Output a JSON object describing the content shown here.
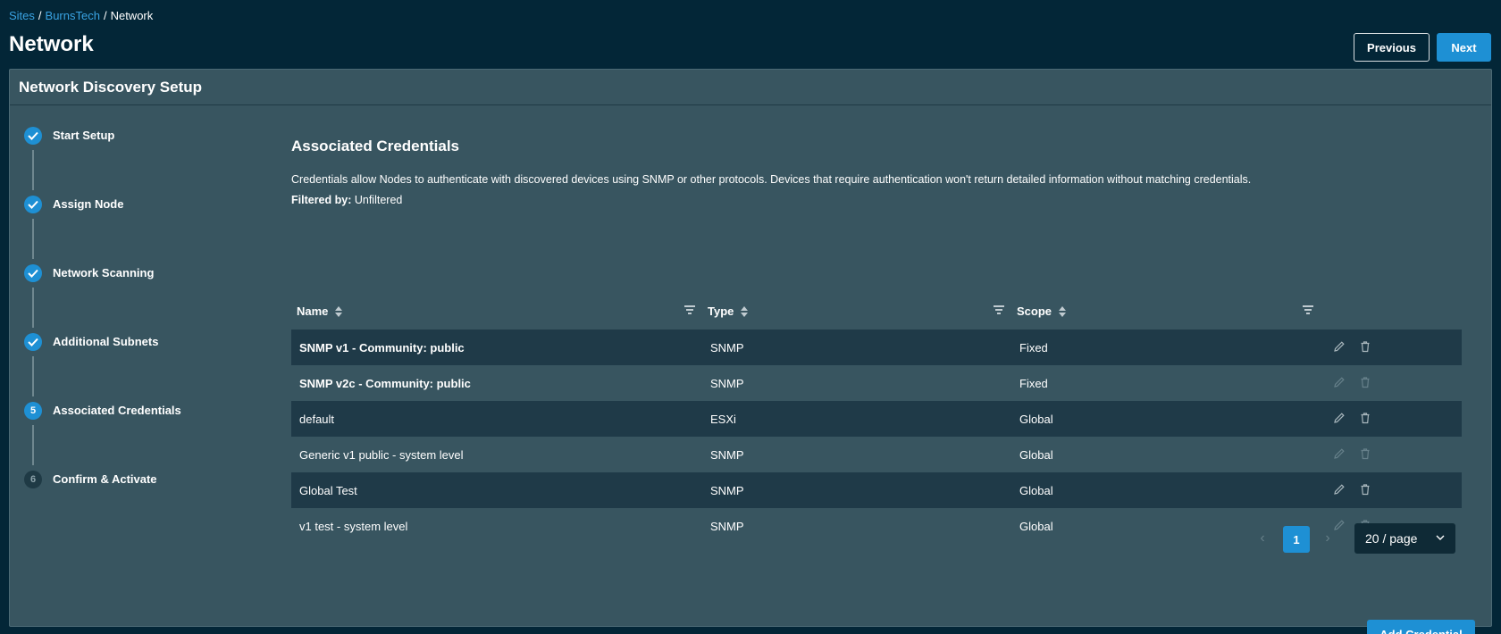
{
  "breadcrumb": {
    "items": [
      "Sites",
      "BurnsTech",
      "Network"
    ],
    "separator": "/"
  },
  "page_title": "Network",
  "header_actions": {
    "previous_label": "Previous",
    "next_label": "Next"
  },
  "panel": {
    "title": "Network Discovery Setup"
  },
  "stepper": {
    "steps": [
      {
        "number": "1",
        "label": "Start Setup",
        "state": "done"
      },
      {
        "number": "2",
        "label": "Assign Node",
        "state": "done"
      },
      {
        "number": "3",
        "label": "Network Scanning",
        "state": "done"
      },
      {
        "number": "4",
        "label": "Additional Subnets",
        "state": "done"
      },
      {
        "number": "5",
        "label": "Associated Credentials",
        "state": "active"
      },
      {
        "number": "6",
        "label": "Confirm & Activate",
        "state": "pending"
      }
    ]
  },
  "content": {
    "title": "Associated Credentials",
    "description": "Credentials allow Nodes to authenticate with discovered devices using SNMP or other protocols. Devices that require authentication won't return detailed information without matching credentials.",
    "filtered_label": "Filtered by:",
    "filtered_value": "Unfiltered"
  },
  "table": {
    "columns": [
      "Name",
      "Type",
      "Scope"
    ],
    "rows": [
      {
        "name": "SNMP v1 - Community: public",
        "type": "SNMP",
        "scope": "Fixed",
        "bold": true,
        "editable": true
      },
      {
        "name": "SNMP v2c - Community: public",
        "type": "SNMP",
        "scope": "Fixed",
        "bold": true,
        "editable": false
      },
      {
        "name": "default",
        "type": "ESXi",
        "scope": "Global",
        "bold": false,
        "editable": true
      },
      {
        "name": "Generic v1 public - system level",
        "type": "SNMP",
        "scope": "Global",
        "bold": false,
        "editable": false
      },
      {
        "name": "Global Test",
        "type": "SNMP",
        "scope": "Global",
        "bold": false,
        "editable": true
      },
      {
        "name": "v1 test - system level",
        "type": "SNMP",
        "scope": "Global",
        "bold": false,
        "editable": false
      }
    ]
  },
  "pagination": {
    "current_page": "1",
    "page_size": "20 / page"
  },
  "add_credential_label": "Add Credential",
  "colors": {
    "background": "#032637",
    "panel": "#385560",
    "accent": "#1e90d4",
    "row_dark": "#1f3a48",
    "link": "#3aa3e3"
  },
  "icons": {
    "step_done": "check-icon",
    "edit": "pencil-icon",
    "delete": "trash-icon",
    "sort": "sort-icon",
    "filter": "filter-icon",
    "dropdown": "chevron-down-icon"
  }
}
